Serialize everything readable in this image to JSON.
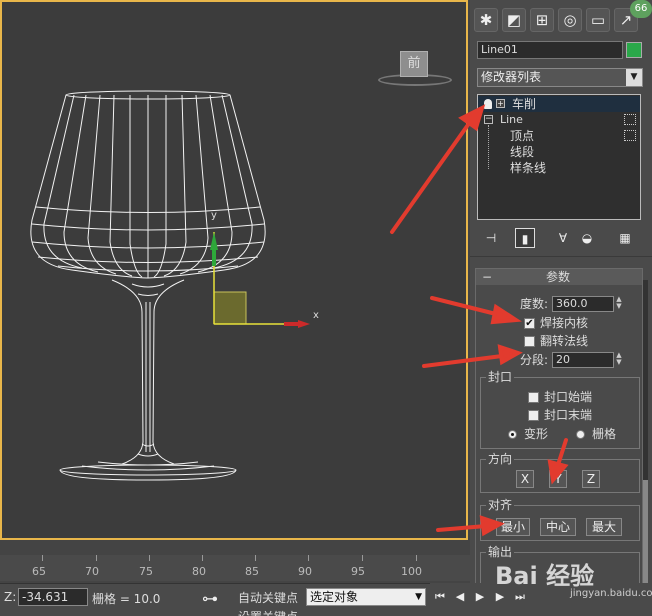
{
  "viewport": {
    "viewcube_label": "前",
    "axis_x": "x",
    "axis_y": "y"
  },
  "panel": {
    "badge": "66",
    "object_name": "Line01",
    "object_color": "#2aa84a",
    "modifier_list": "修改器列表",
    "stack": {
      "top_modifier": "车削",
      "base_object": "Line",
      "sub_items": [
        "顶点",
        "线段",
        "样条线"
      ]
    },
    "params": {
      "title": "参数",
      "degrees_label": "度数:",
      "degrees_value": "360.0",
      "weld_core_label": "焊接内核",
      "weld_core_checked": true,
      "flip_normals_label": "翻转法线",
      "flip_normals_checked": false,
      "segments_label": "分段:",
      "segments_value": "20",
      "capping": {
        "title": "封口",
        "cap_start": "封口始端",
        "cap_end": "封口末端",
        "morph": "变形",
        "grid": "栅格"
      },
      "direction": {
        "title": "方向",
        "x": "X",
        "y": "Y",
        "z": "Z"
      },
      "align": {
        "title": "对齐",
        "min": "最小",
        "center": "中心",
        "max": "最大"
      },
      "output": {
        "title": "输出"
      }
    }
  },
  "timeline": {
    "ticks": [
      "65",
      "70",
      "75",
      "80",
      "85",
      "90",
      "95",
      "100"
    ]
  },
  "status": {
    "z_label": "Z:",
    "z_value": "-34.631",
    "grid": "栅格 = 10.0",
    "auto_key": "自动关键点",
    "set_key": "设置关键点",
    "selection_set": "选定对象"
  },
  "watermark": {
    "text": "Bai 经验",
    "sub": "jingyan.baidu.com"
  },
  "colors": {
    "viewport_border": "#e8b64a",
    "annotation_arrow": "#e23b2e",
    "selection_color": "#2aa84a"
  }
}
